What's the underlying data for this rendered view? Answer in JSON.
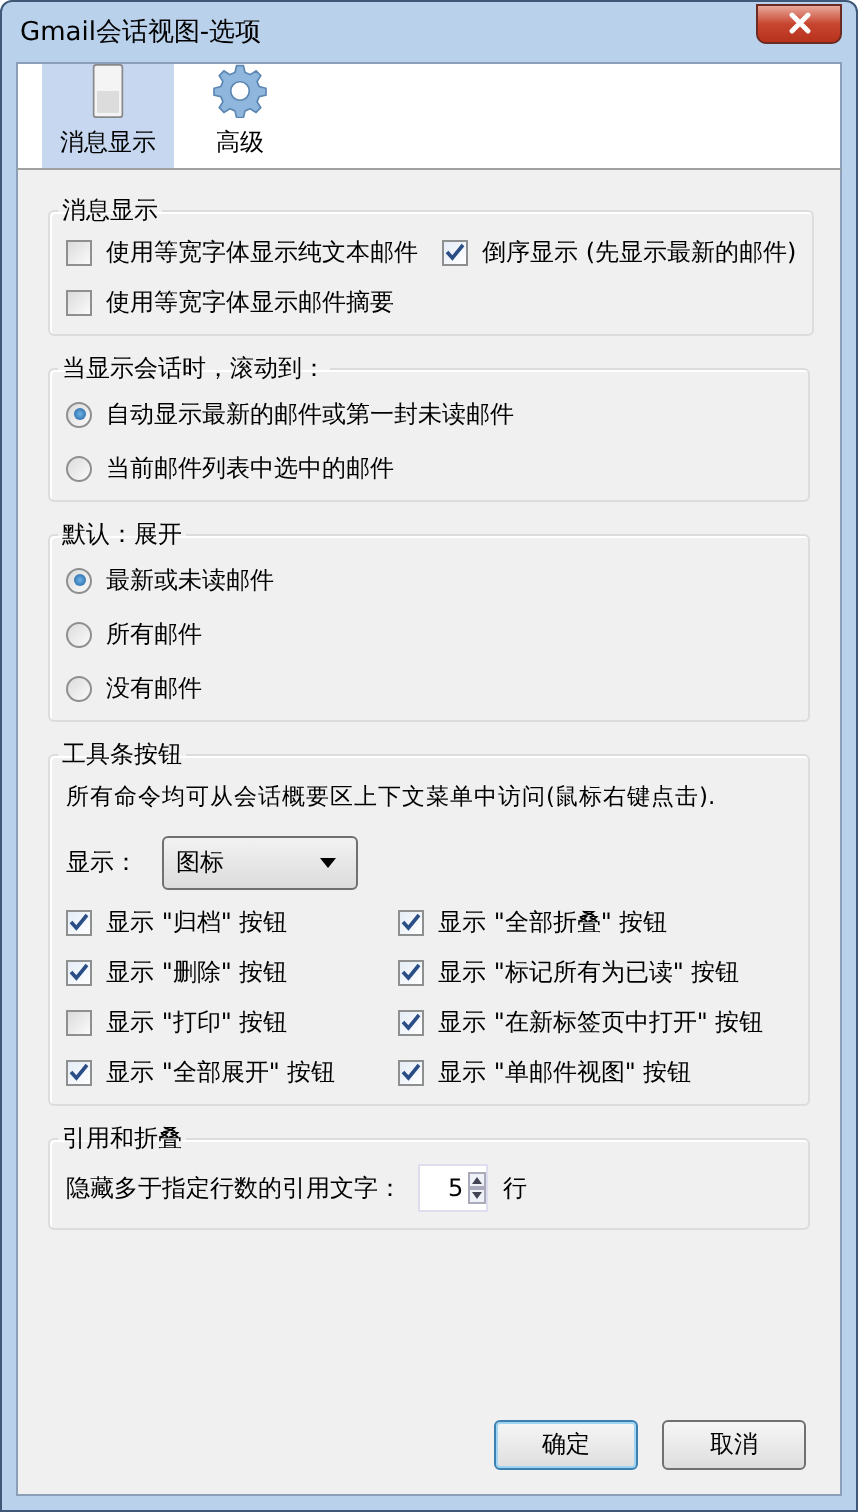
{
  "window": {
    "title": "Gmail会话视图-选项"
  },
  "tabs": [
    {
      "label": "消息显示",
      "kind": "switch",
      "selected": true
    },
    {
      "label": "高级",
      "kind": "gear",
      "selected": false
    }
  ],
  "sections": [
    {
      "title": "消息显示",
      "kind": "checks",
      "items": [
        {
          "label": "使用等宽字体显示纯文本邮件",
          "checked": false
        },
        {
          "label": "倒序显示 (先显示最新的邮件)",
          "checked": true
        },
        {
          "label": "使用等宽字体显示邮件摘要",
          "checked": false
        }
      ]
    },
    {
      "title": "当显示会话时，滚动到：",
      "kind": "radios",
      "items": [
        {
          "label": "自动显示最新的邮件或第一封未读邮件",
          "selected": true
        },
        {
          "label": "当前邮件列表中选中的邮件",
          "selected": false
        }
      ]
    },
    {
      "title": "默认：展开",
      "kind": "radios",
      "items": [
        {
          "label": "最新或未读邮件",
          "selected": true
        },
        {
          "label": "所有邮件",
          "selected": false
        },
        {
          "label": "没有邮件",
          "selected": false
        }
      ]
    },
    {
      "title": "工具条按钮",
      "kind": "toolbar",
      "description": "所有命令均可从会话概要区上下文菜单中访问(鼠标右键点击).",
      "display": {
        "label": "显示：",
        "value": "图标"
      },
      "items": [
        {
          "label": "显示 \"归档\" 按钮",
          "checked": true
        },
        {
          "label": "显示 \"全部折叠\" 按钮",
          "checked": true
        },
        {
          "label": "显示 \"删除\" 按钮",
          "checked": true
        },
        {
          "label": "显示 \"标记所有为已读\" 按钮",
          "checked": true
        },
        {
          "label": "显示 \"打印\" 按钮",
          "checked": false
        },
        {
          "label": "显示 \"在新标签页中打开\" 按钮",
          "checked": true
        },
        {
          "label": "显示 \"全部展开\" 按钮",
          "checked": true
        },
        {
          "label": "显示 \"单邮件视图\" 按钮",
          "checked": true
        }
      ]
    },
    {
      "title": "引用和折叠",
      "kind": "quote",
      "label": "隐藏多于指定行数的引用文字：",
      "value": "5",
      "unit": "行"
    }
  ],
  "buttons": [
    {
      "label": "确定",
      "default": true
    },
    {
      "label": "取消",
      "default": false
    }
  ]
}
